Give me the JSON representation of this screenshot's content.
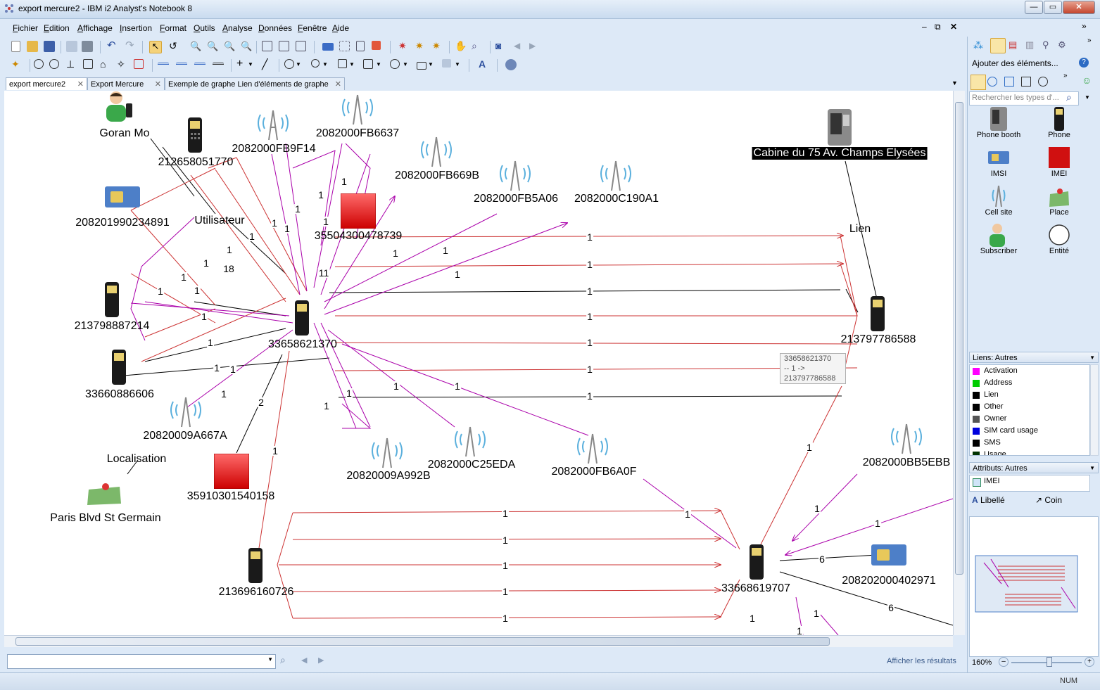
{
  "window": {
    "title": "export mercure2 - IBM i2 Analyst's Notebook 8"
  },
  "menu": [
    "Fichier",
    "Edition",
    "Affichage",
    "Insertion",
    "Format",
    "Outils",
    "Analyse",
    "Données",
    "Fenêtre",
    "Aide"
  ],
  "tabs": [
    {
      "label": "export mercure2",
      "active": true
    },
    {
      "label": "Export Mercure",
      "active": false
    },
    {
      "label": "Exemple de graphe Lien d'éléments de graphe",
      "active": false
    }
  ],
  "chart": {
    "entities": [
      {
        "label": "Goran Mo"
      },
      {
        "label": "212658051770"
      },
      {
        "label": "2082000FB9F14"
      },
      {
        "label": "2082000FB6637"
      },
      {
        "label": "2082000FB669B"
      },
      {
        "label": "2082000FB5A06"
      },
      {
        "label": "2082000C190A1"
      },
      {
        "label": "208201990234891"
      },
      {
        "label": "Utilisateur"
      },
      {
        "label": "35504300478739"
      },
      {
        "label": "213798887214"
      },
      {
        "label": "33658621370"
      },
      {
        "label": "33660886606"
      },
      {
        "label": "20820009A667A"
      },
      {
        "label": "Localisation"
      },
      {
        "label": "Paris Blvd St Germain"
      },
      {
        "label": "35910301540158"
      },
      {
        "label": "20820009A992B"
      },
      {
        "label": "2082000C25EDA"
      },
      {
        "label": "2082000FB6A0F"
      },
      {
        "label": "Cabine du 75 Av. Champs Elysées"
      },
      {
        "label": "Lien"
      },
      {
        "label": "213797786588"
      },
      {
        "label": "2082000BB5EBB"
      },
      {
        "label": "208202000402971"
      },
      {
        "label": "213696160726"
      },
      {
        "label": "33668619707"
      }
    ],
    "link_counts": [
      "1",
      "1",
      "1",
      "1",
      "1",
      "1",
      "1",
      "1",
      "1",
      "18",
      "11",
      "1",
      "1",
      "1",
      "1",
      "1",
      "1",
      "1",
      "2",
      "1",
      "1",
      "1",
      "1",
      "1",
      "1",
      "1",
      "1",
      "1",
      "1",
      "1",
      "1",
      "1",
      "1",
      "1",
      "1",
      "1",
      "1",
      "1",
      "1",
      "1",
      "1",
      "1",
      "1",
      "1",
      "1",
      "6",
      "6",
      "1",
      "1"
    ],
    "tooltip": {
      "line1": "33658621370",
      "line2": "-- 1 ->",
      "line3": "213797786588"
    }
  },
  "right_panel": {
    "add_title": "Ajouter des éléments...",
    "search_placeholder": "Rechercher les types d'...",
    "palette": [
      "Phone booth",
      "Phone",
      "IMSI",
      "IMEI",
      "Cell site",
      "Place",
      "Subscriber",
      "Entité"
    ],
    "links_title": "Liens: Autres",
    "links": [
      {
        "label": "Activation",
        "color": "#ff00ff"
      },
      {
        "label": "Address",
        "color": "#00cc00"
      },
      {
        "label": "Lien",
        "color": "#000000"
      },
      {
        "label": "Other",
        "color": "#000000"
      },
      {
        "label": "Owner",
        "color": "#555555"
      },
      {
        "label": "SIM card usage",
        "color": "#0000dd"
      },
      {
        "label": "SMS",
        "color": "#000000"
      },
      {
        "label": "Usage",
        "color": "#003300"
      }
    ],
    "attrs_title": "Attributs: Autres",
    "attrs": [
      "IMEI"
    ],
    "label_btn": "Libellé",
    "corner_btn": "Coin",
    "zoom": "160%"
  },
  "search": {
    "results_label": "Afficher les résultats"
  },
  "status": {
    "num": "NUM"
  }
}
